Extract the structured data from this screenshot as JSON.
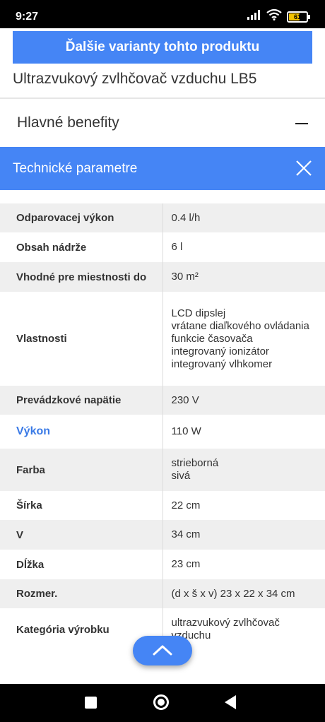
{
  "status_bar": {
    "time": "9:27",
    "battery_level": "61",
    "battery_fraction": 0.61
  },
  "variants_button": {
    "label": "Ďalšie varianty tohto produktu"
  },
  "product": {
    "name": "Ultrazvukový zvlhčovač vzduchu LB5"
  },
  "benefits": {
    "label": "Hlavné benefity"
  },
  "tech_params": {
    "title": "Technické parametre",
    "rows": [
      {
        "name": "Odparovacej výkon",
        "values": [
          "0.4 l/h"
        ]
      },
      {
        "name": "Obsah nádrže",
        "values": [
          "6 l"
        ]
      },
      {
        "name": "Vhodné pre miestnosti do",
        "values": [
          "30 m²"
        ]
      },
      {
        "name": "Vlastnosti",
        "values": [
          "LCD dipslej",
          "vrátane diaľkového ovládania",
          "funkcie časovača",
          "integrovaný ionizátor",
          "integrovaný vlhkomer"
        ]
      },
      {
        "name": "Prevádzkové napätie",
        "values": [
          "230 V"
        ]
      },
      {
        "name": "Výkon",
        "values": [
          "110 W"
        ]
      },
      {
        "name": "Farba",
        "values": [
          "strieborná",
          "sivá"
        ]
      },
      {
        "name": "Šírka",
        "values": [
          "22 cm"
        ]
      },
      {
        "name": "V",
        "values": [
          "34 cm"
        ]
      },
      {
        "name": "Dĺžka",
        "values": [
          "23 cm"
        ]
      },
      {
        "name": "Rozmer.",
        "values": [
          "(d x š x v) 23 x 22 x 34 cm"
        ]
      },
      {
        "name": "Kategória výrobku",
        "values": [
          "ultrazvukový zvlhčovač",
          "vzduchu"
        ]
      }
    ]
  },
  "colors": {
    "accent": "#4585f5",
    "link": "#3a7ae6",
    "row_shade": "#efefef"
  },
  "icons": {
    "collapse": "minus-icon",
    "close": "close-icon",
    "scroll_up": "chevron-up-icon"
  }
}
